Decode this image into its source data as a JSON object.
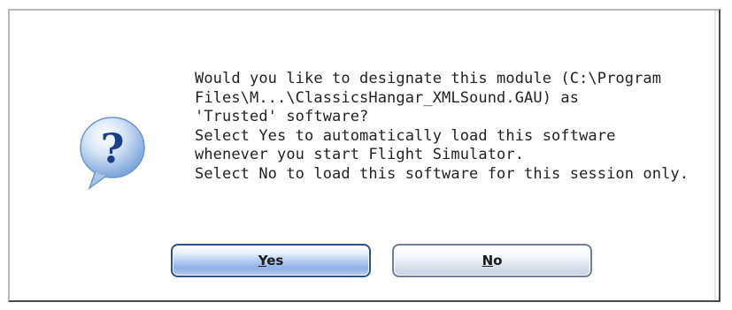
{
  "dialog": {
    "icon": "question-icon",
    "message_lines": [
      "Would you like to designate this module (C:\\Program",
      "Files\\M...\\ClassicsHangar_XMLSound.GAU) as",
      "'Trusted' software?",
      "Select Yes to automatically load this software",
      "whenever you start Flight Simulator.",
      "Select No to load this software for this session only."
    ],
    "buttons": {
      "yes": {
        "mnemonic": "Y",
        "rest": "es"
      },
      "no": {
        "mnemonic": "N",
        "rest": "o"
      }
    }
  },
  "colors": {
    "icon_fill": "#7fa8dc",
    "icon_mark": "#1c3f8a",
    "yes_border": "#2b4f86",
    "no_border": "#6f7d96"
  }
}
